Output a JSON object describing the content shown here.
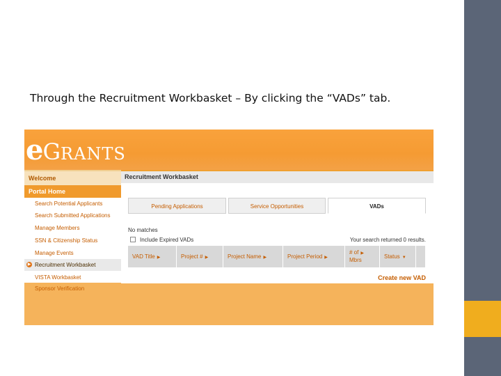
{
  "caption": "Through the Recruitment Workbasket – By clicking the “VADs” tab.",
  "logo": {
    "e": "e",
    "g": "G",
    "rest": "RANTS"
  },
  "nav": {
    "welcome": "Welcome",
    "portal_home": "Portal Home",
    "items": [
      {
        "label": "Search Potential Applicants"
      },
      {
        "label": "Search Submitted Applications"
      },
      {
        "label": "Manage Members"
      },
      {
        "label": "SSN & Citizenship Status"
      },
      {
        "label": "Manage Events"
      },
      {
        "label": "Recruitment Workbasket",
        "active": true
      },
      {
        "label": "VISTA Workbasket"
      },
      {
        "label": "Sponsor Verification"
      }
    ]
  },
  "main": {
    "title": "Recruitment Workbasket",
    "tabs": [
      {
        "label": "Pending Applications"
      },
      {
        "label": "Service Opportunities"
      },
      {
        "label": "VADs",
        "active": true
      }
    ],
    "no_matches": "No matches",
    "include_expired": "Include Expired VADs",
    "results_text": "Your search returned 0 results.",
    "columns": [
      {
        "label": "VAD Title"
      },
      {
        "label": "Project #"
      },
      {
        "label": "Project Name"
      },
      {
        "label": "Project Period"
      },
      {
        "label_line1": "# of",
        "label_line2": "Mbrs"
      },
      {
        "label": "Status"
      }
    ],
    "create_link": "Create new VAD"
  },
  "colors": {
    "banner": "#f59b33",
    "accent_link": "#c55d00",
    "side_dark": "#5b6577",
    "side_gold": "#f0ad1e"
  }
}
